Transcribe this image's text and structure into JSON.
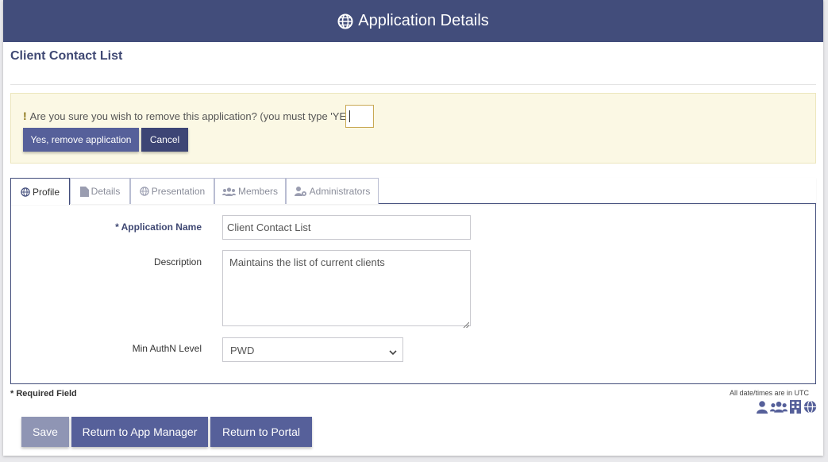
{
  "header": {
    "title": "Application Details",
    "icon": "globe-icon"
  },
  "app": {
    "name": "Client Contact List"
  },
  "alert": {
    "message": "Are you sure you wish to remove this application? (you must type 'YES')",
    "input_value": "",
    "remove_label": "Yes, remove application",
    "cancel_label": "Cancel"
  },
  "tabs": [
    {
      "label": "Profile",
      "icon": "globe-icon",
      "active": true
    },
    {
      "label": "Details",
      "icon": "file-icon",
      "active": false
    },
    {
      "label": "Presentation",
      "icon": "globe-icon",
      "active": false
    },
    {
      "label": "Members",
      "icon": "users-icon",
      "active": false
    },
    {
      "label": "Administrators",
      "icon": "user-gear-icon",
      "active": false
    }
  ],
  "form": {
    "name_label": "* Application Name",
    "name_value": "Client Contact List",
    "desc_label": "Description",
    "desc_value": "Maintains the list of current clients",
    "authn_label": "Min AuthN Level",
    "authn_value": "PWD"
  },
  "footer": {
    "required_note": "* Required Field",
    "utc_note": "All date/times are in UTC",
    "save_label": "Save",
    "app_manager_label": "Return to App Manager",
    "portal_label": "Return to Portal",
    "icons": [
      "user-icon",
      "users-icon",
      "building-icon",
      "globe-icon"
    ]
  },
  "colors": {
    "header_bg": "#424d7b",
    "button_bg": "#56609a",
    "alert_bg": "#fbf8e4"
  }
}
